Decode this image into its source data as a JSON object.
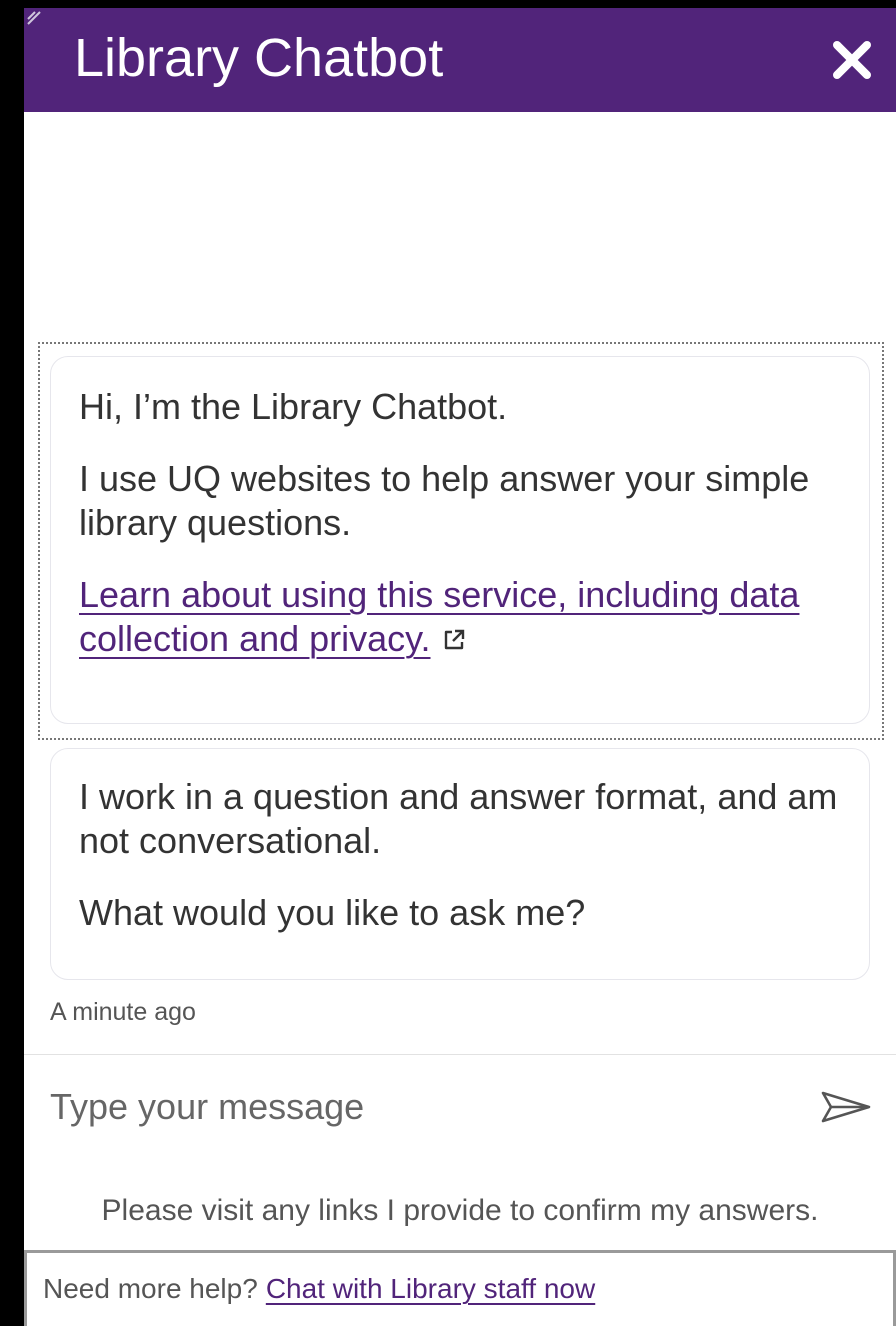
{
  "header": {
    "title": "Library Chatbot",
    "close_icon": "close-icon",
    "background": "#51247a"
  },
  "messages": [
    {
      "paragraphs": [
        "Hi, I’m the Library Chatbot.",
        "I use UQ websites to help answer your simple library questions."
      ],
      "link": {
        "text": "Learn about using this service, including data collection and privacy.",
        "icon": "external-link-icon"
      }
    },
    {
      "paragraphs": [
        "I work in a question and answer format, and am not conversational.",
        "What would you like to ask me?"
      ]
    }
  ],
  "timestamp": "A minute ago",
  "composer": {
    "placeholder": "Type your message",
    "value": "",
    "send_icon": "send-icon"
  },
  "disclaimer": "Please visit any links I provide to confirm my answers.",
  "footer": {
    "prompt": "Need more help?",
    "link_text": "Chat with Library staff now"
  },
  "colors": {
    "brand_purple": "#51247a",
    "text": "#333333",
    "muted_text": "#555555"
  }
}
